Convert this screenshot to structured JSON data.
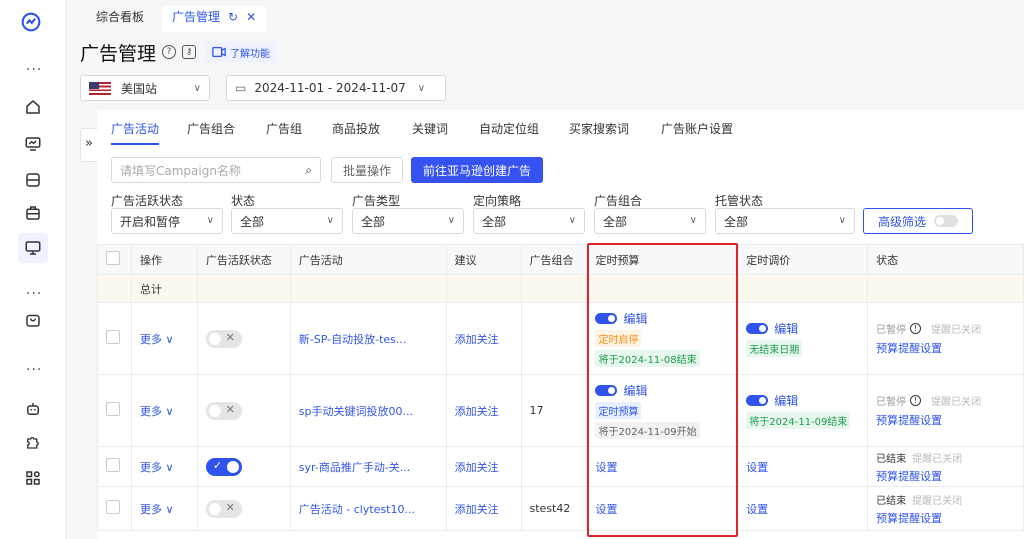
{
  "rail": {
    "icons": [
      "logo-icon",
      "more-icon",
      "home-icon",
      "dashboard-icon",
      "inbox-icon",
      "briefcase-icon",
      "monitor-icon",
      "more-icon",
      "bag-icon",
      "more-icon",
      "robot-icon",
      "puzzle-icon",
      "apps-icon"
    ]
  },
  "tabs": [
    {
      "label": "综合看板"
    },
    {
      "label": "广告管理"
    }
  ],
  "page": {
    "title": "广告管理",
    "learn": "了解功能"
  },
  "top_filters": {
    "site": "美国站",
    "date_range": "2024-11-01 - 2024-11-07"
  },
  "subtabs": [
    "广告活动",
    "广告组合",
    "广告组",
    "商品投放",
    "关键词",
    "自动定位组",
    "买家搜索词",
    "广告账户设置"
  ],
  "search": {
    "placeholder": "请填写Campaign名称",
    "batch": "批量操作",
    "create": "前往亚马逊创建广告"
  },
  "filter_labels": [
    "广告活跃状态",
    "状态",
    "广告类型",
    "定向策略",
    "广告组合",
    "托管状态"
  ],
  "filter_values": [
    "开启和暂停",
    "全部",
    "全部",
    "全部",
    "全部",
    "全部"
  ],
  "advanced": "高级筛选",
  "columns": [
    "操作",
    "广告活跃状态",
    "广告活动",
    "建议",
    "广告组合",
    "定时预算",
    "定时调价",
    "状态"
  ],
  "total_label": "总计",
  "rows": [
    {
      "action": "更多",
      "active": false,
      "campaign": "新-SP-自动投放-tes...",
      "suggest": "添加关注",
      "portfolio": "",
      "budget": {
        "edit": "编辑",
        "tag1": "定时启停",
        "tag2": "将于2024-11-08结束"
      },
      "bid": {
        "edit": "编辑",
        "tag1": "无结束日期"
      },
      "status": {
        "state": "已暂停",
        "alert": "提醒已关闭",
        "link": "预算提醒设置"
      }
    },
    {
      "action": "更多",
      "active": false,
      "campaign": "sp手动关键词投放00...",
      "suggest": "添加关注",
      "portfolio": "17",
      "budget": {
        "edit": "编辑",
        "tag1": "定时预算",
        "tag2": "将于2024-11-09开始"
      },
      "bid": {
        "edit": "编辑",
        "tag1": "将于2024-11-09结束"
      },
      "status": {
        "state": "已暂停",
        "alert": "提醒已关闭",
        "link": "预算提醒设置"
      }
    },
    {
      "action": "更多",
      "active": true,
      "campaign": "syr-商品推广手动-关...",
      "suggest": "添加关注",
      "portfolio": "",
      "budget": {
        "set": "设置"
      },
      "bid": {
        "set": "设置"
      },
      "status": {
        "state": "已结束",
        "alert": "提醒已关闭",
        "link": "预算提醒设置"
      }
    },
    {
      "action": "更多",
      "active": false,
      "campaign": "广告活动 - clytest10...",
      "suggest": "添加关注",
      "portfolio": "stest42",
      "budget": {
        "set": "设置"
      },
      "bid": {
        "set": "设置"
      },
      "status": {
        "state": "已结束",
        "alert": "提醒已关闭",
        "link": "预算提醒设置"
      }
    }
  ],
  "colors": {
    "accent": "#2f54eb",
    "highlight_box": "#e0242c"
  }
}
